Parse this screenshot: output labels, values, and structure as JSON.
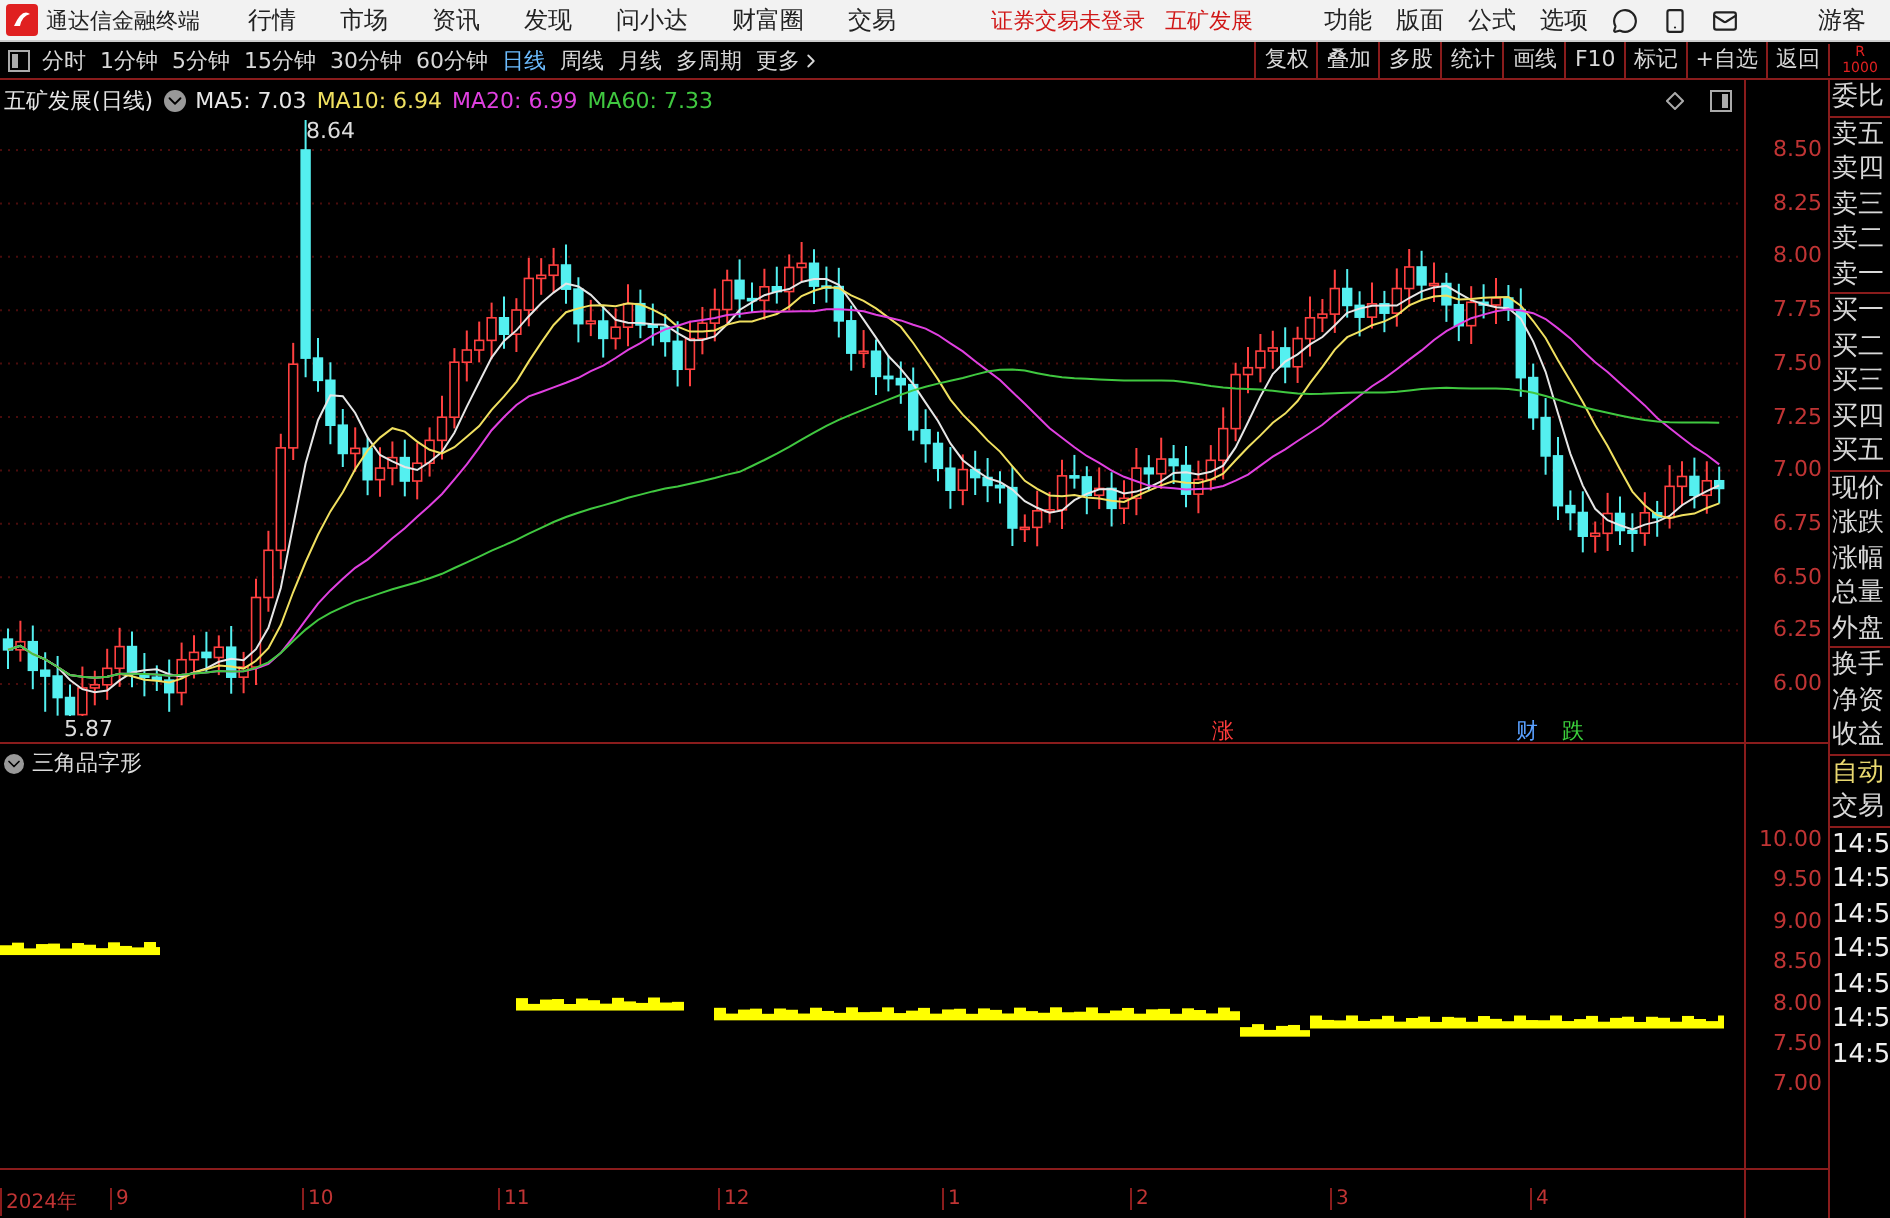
{
  "app_bar": {
    "title": "通达信金融终端",
    "menu": [
      "行情",
      "市场",
      "资讯",
      "发现",
      "问小达",
      "财富圈",
      "交易"
    ],
    "notices": [
      "证券交易未登录",
      "五矿发展"
    ],
    "actions": [
      "功能",
      "版面",
      "公式",
      "选项"
    ],
    "user": "游客"
  },
  "period_bar": {
    "periods": [
      {
        "label": "分时",
        "selected": false
      },
      {
        "label": "1分钟",
        "selected": false
      },
      {
        "label": "5分钟",
        "selected": false
      },
      {
        "label": "15分钟",
        "selected": false
      },
      {
        "label": "30分钟",
        "selected": false
      },
      {
        "label": "60分钟",
        "selected": false
      },
      {
        "label": "日线",
        "selected": true
      },
      {
        "label": "周线",
        "selected": false
      },
      {
        "label": "月线",
        "selected": false
      },
      {
        "label": "多周期",
        "selected": false
      }
    ],
    "more": "更多",
    "tools": [
      "复权",
      "叠加",
      "多股",
      "统计",
      "画线",
      "F10",
      "标记",
      "+自选",
      "返回"
    ],
    "corner": [
      "R",
      "1000"
    ]
  },
  "main_chart": {
    "title": "五矿发展(日线)",
    "ma": [
      {
        "label": "MA5: 7.03",
        "color": "#e6e6e6"
      },
      {
        "label": "MA10: 6.94",
        "color": "#f0e060"
      },
      {
        "label": "MA20: 6.99",
        "color": "#e040e0"
      },
      {
        "label": "MA60: 7.33",
        "color": "#40c840"
      }
    ],
    "price_axis": [
      "8.50",
      "8.25",
      "8.00",
      "7.75",
      "7.50",
      "7.25",
      "7.00",
      "6.75",
      "6.50",
      "6.25",
      "6.00"
    ],
    "high_label": "8.64",
    "low_label": "5.87",
    "events": [
      {
        "label": "涨",
        "color": "#ff3c3c"
      },
      {
        "label": "财",
        "color": "#5aa0ff"
      },
      {
        "label": "跌",
        "color": "#3cd23c"
      }
    ]
  },
  "indicator": {
    "title": "三角品字形",
    "axis": [
      "10.00",
      "9.50",
      "9.00",
      "8.50",
      "8.00",
      "7.50",
      "7.00"
    ]
  },
  "time_axis": [
    "2024年",
    "9",
    "10",
    "11",
    "12",
    "1",
    "2",
    "3",
    "4"
  ],
  "side_panel": {
    "groups": [
      [
        "委比"
      ],
      [
        "卖五",
        "卖四",
        "卖三",
        "卖二",
        "卖一"
      ],
      [
        "买一",
        "买二",
        "买三",
        "买四",
        "买五"
      ],
      [
        "现价",
        "涨跌",
        "涨幅",
        "总量",
        "外盘"
      ],
      [
        "换手",
        "净资",
        "收益"
      ]
    ],
    "auto": "自动",
    "trade": "交易",
    "times": [
      "14:5",
      "14:5",
      "14:5",
      "14:5",
      "14:5",
      "14:5",
      "14:5"
    ]
  }
}
